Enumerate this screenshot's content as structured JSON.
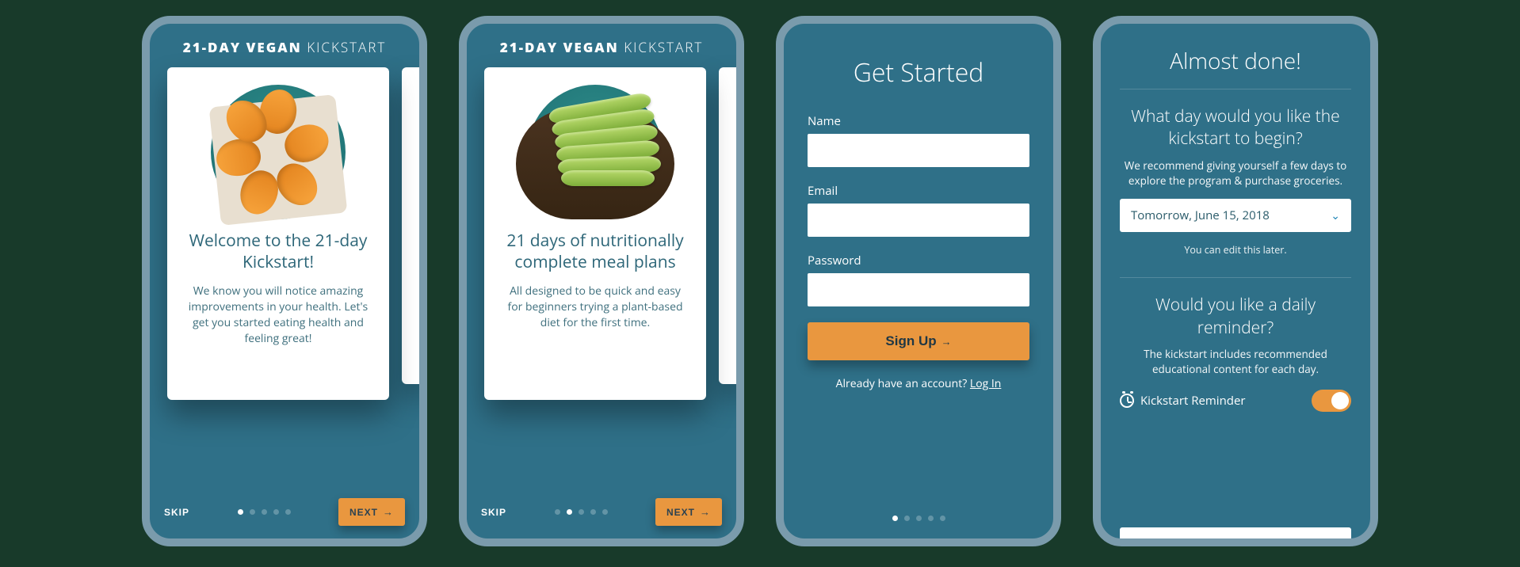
{
  "app_title_bold": "21-DAY VEGAN",
  "app_title_light": "KICKSTART",
  "skip_label": "SKIP",
  "next_label": "NEXT",
  "screens": {
    "onboard1": {
      "heading": "Welcome to the 21-day Kickstart!",
      "body": "We know you will notice amazing improvements in your health. Let's get you started eating health and feeling great!"
    },
    "onboard2": {
      "heading": "21 days of nutritionally complete meal plans",
      "body": "All designed to be quick and easy for beginners trying a plant-based diet for the first time."
    },
    "signup": {
      "title": "Get Started",
      "labels": {
        "name": "Name",
        "email": "Email",
        "password": "Password"
      },
      "values": {
        "name": "",
        "email": "",
        "password": ""
      },
      "submit": "Sign Up",
      "have_account": "Already have an account?",
      "login": "Log In"
    },
    "setup": {
      "title": "Almost done!",
      "q1": "What day would you like the kickstart to begin?",
      "hint1": "We recommend giving yourself a few days to explore the program & purchase groceries.",
      "date_selected": "Tomorrow, June 15, 2018",
      "edit_note": "You can edit this later.",
      "q2": "Would you like a daily reminder?",
      "hint2": "The kickstart includes recommended educational content for each day.",
      "toggle_label": "Kickstart Reminder",
      "toggle_on": true
    }
  },
  "colors": {
    "accent": "#e9973f",
    "bg": "#2f7088"
  }
}
